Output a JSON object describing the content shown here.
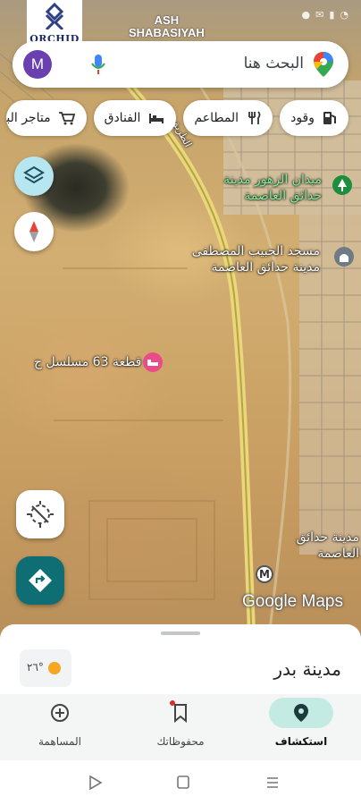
{
  "status_bar": {
    "brand_name": "ORCHID",
    "place_tag_line1": "ASH",
    "place_tag_line2": "SHABASIYAH",
    "icons": [
      "wifi-icon",
      "signal-icon",
      "message-icon",
      "notification-icon"
    ]
  },
  "search": {
    "placeholder": "البحث هنا",
    "avatar_letter": "M"
  },
  "chips": [
    {
      "label": "وقود",
      "icon": "fuel-icon"
    },
    {
      "label": "المطاعم",
      "icon": "restaurant-icon"
    },
    {
      "label": "الفنادق",
      "icon": "hotel-icon"
    },
    {
      "label": "متاجر البق",
      "icon": "cart-icon"
    }
  ],
  "map": {
    "road_label": "الطريق",
    "labels": {
      "park": "ميدان الزهور مدينة\nحدائق العاصمة",
      "mosque": "مسجد الحبيب المصطفى\nمدينة حدائق العاصمة",
      "plot": "قطعة 63 مسلسل ج",
      "city": "مدينة حدائق\nالعاصمة",
      "metro": "M"
    },
    "watermark": "Google Maps"
  },
  "sheet": {
    "city": "مدينة بدر",
    "temperature": "٢٦°"
  },
  "bottom_nav": [
    {
      "label": "استكشاف",
      "icon": "explore-pin-icon",
      "active": true
    },
    {
      "label": "محفوظاتك",
      "icon": "bookmark-icon",
      "active": false
    },
    {
      "label": "المساهمة",
      "icon": "add-circle-icon",
      "active": false
    }
  ],
  "colors": {
    "accent": "#0f6e74",
    "avatar": "#6a3fb0",
    "active_tab": "#c4ebe3"
  }
}
